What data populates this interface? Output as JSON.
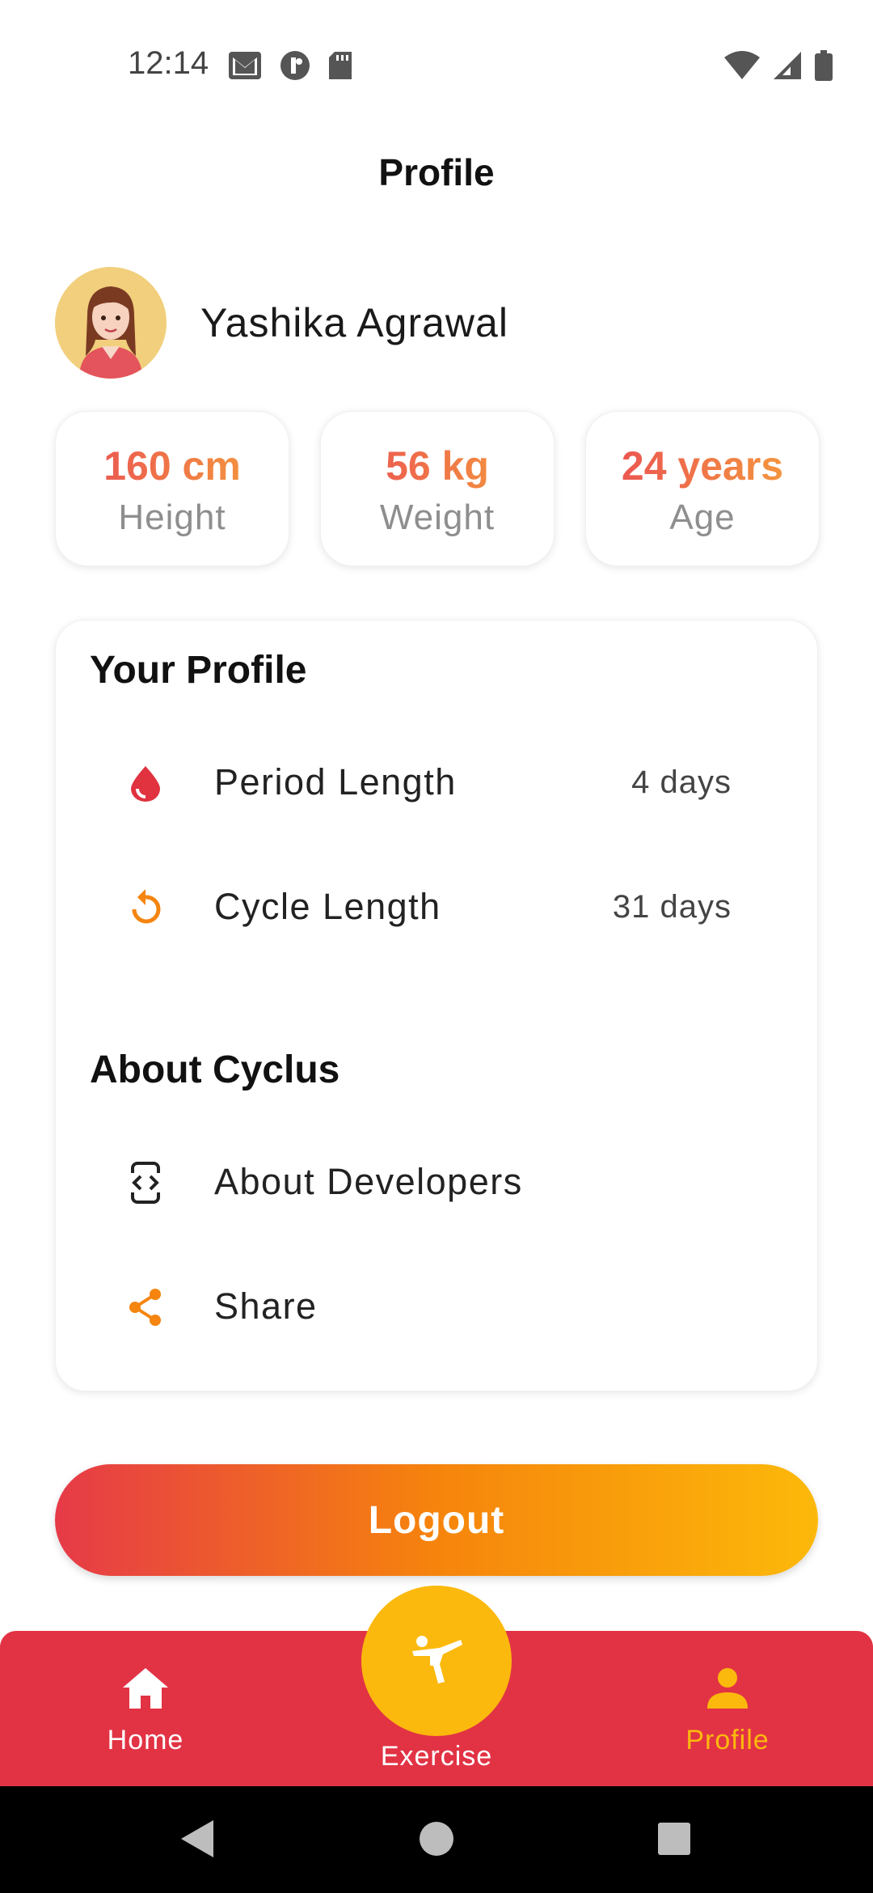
{
  "status_bar": {
    "time": "12:14",
    "left_icons": [
      "gmail-icon",
      "app-icon",
      "sd-card-icon"
    ],
    "right_icons": [
      "wifi-icon",
      "signal-icon",
      "battery-icon"
    ]
  },
  "header": {
    "title": "Profile"
  },
  "user": {
    "name": "Yashika Agrawal",
    "avatar": "avatar-illustration"
  },
  "stats": [
    {
      "value": "160 cm",
      "label": "Height"
    },
    {
      "value": "56 kg",
      "label": "Weight"
    },
    {
      "value": "24 years",
      "label": "Age"
    }
  ],
  "your_profile": {
    "title": "Your Profile",
    "items": [
      {
        "icon": "blood-drop-icon",
        "label": "Period Length",
        "value": "4 days",
        "icon_color": "#e0323f"
      },
      {
        "icon": "refresh-icon",
        "label": "Cycle Length",
        "value": "31 days",
        "icon_color": "#f5850f"
      }
    ]
  },
  "about": {
    "title": "About Cyclus",
    "items": [
      {
        "icon": "developer-mode-icon",
        "label": "About Developers"
      },
      {
        "icon": "share-icon",
        "label": "Share",
        "icon_color": "#f5850f"
      }
    ]
  },
  "logout": {
    "label": "Logout"
  },
  "bottom_nav": {
    "items": [
      {
        "icon": "home-icon",
        "label": "Home",
        "active": false
      },
      {
        "icon": "exercise-icon",
        "label": "Exercise",
        "active": false
      },
      {
        "icon": "person-icon",
        "label": "Profile",
        "active": true
      }
    ],
    "background": "#e23345",
    "active_color": "#fcb90d"
  },
  "colors": {
    "accent_red": "#e63a48",
    "accent_orange": "#f6840c",
    "accent_yellow": "#fcb90a"
  }
}
